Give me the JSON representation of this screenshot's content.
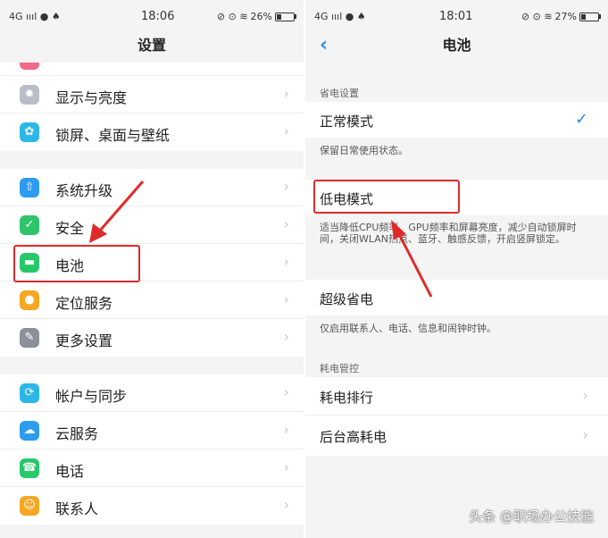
{
  "left": {
    "status": {
      "signal": "4G ıııl",
      "icons": "● ♠",
      "time": "18:06",
      "right_icons": "⊘ ⊙ ≋",
      "battery": "26%",
      "battery_level": 0.26
    },
    "title": "设置",
    "groups": [
      [
        {
          "label": "显示与亮度",
          "icon": "sun-icon",
          "color": "#b9bec6"
        },
        {
          "label": "锁屏、桌面与壁纸",
          "icon": "palette-icon",
          "color": "#2db7e8"
        }
      ],
      [
        {
          "label": "系统升级",
          "icon": "upgrade-icon",
          "color": "#2d9bf0"
        },
        {
          "label": "安全",
          "icon": "shield-icon",
          "color": "#2ec46b"
        },
        {
          "label": "电池",
          "icon": "battery-icon",
          "color": "#27c86a"
        },
        {
          "label": "定位服务",
          "icon": "location-icon",
          "color": "#f5a623"
        },
        {
          "label": "更多设置",
          "icon": "wrench-icon",
          "color": "#8a8f99"
        }
      ],
      [
        {
          "label": "帐户与同步",
          "icon": "account-sync-icon",
          "color": "#2db7e8"
        },
        {
          "label": "云服务",
          "icon": "cloud-icon",
          "color": "#2d9bf0"
        },
        {
          "label": "电话",
          "icon": "phone-icon",
          "color": "#27c86a"
        },
        {
          "label": "联系人",
          "icon": "contacts-icon",
          "color": "#f5a623"
        }
      ]
    ]
  },
  "right": {
    "status": {
      "signal": "4G ıııl",
      "icons": "● ♠",
      "time": "18:01",
      "right_icons": "⊘ ⊙ ≋",
      "battery": "27%",
      "battery_level": 0.27
    },
    "title": "电池",
    "section_power_saving": "省电设置",
    "normal_mode": "正常模式",
    "normal_desc": "保留日常使用状态。",
    "low_power_mode": "低电模式",
    "low_power_desc": "适当降低CPU频率、GPU频率和屏幕亮度，减少自动锁屏时间，关闭WLAN热点、蓝牙、触感反馈，开启竖屏锁定。",
    "super_saver": "超级省电",
    "super_desc": "仅启用联系人、电话、信息和闹钟时钟。",
    "section_consumption": "耗电管控",
    "consumption_rank": "耗电排行",
    "background_high": "后台高耗电"
  },
  "watermark": "头条 @职场办公技能"
}
